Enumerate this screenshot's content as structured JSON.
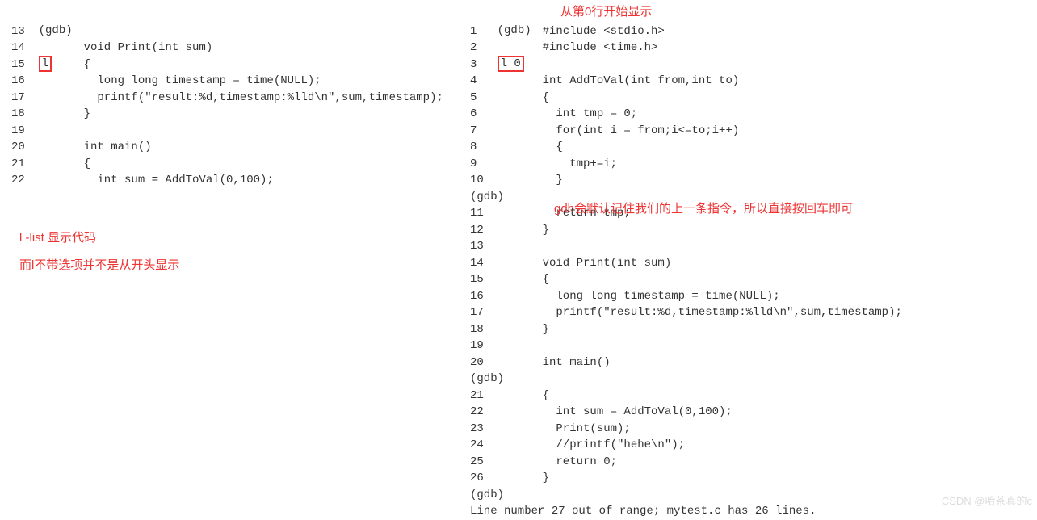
{
  "left": {
    "prompt": "(gdb)",
    "cmd_boxed": "l",
    "lines": [
      {
        "n": "13",
        "t": ""
      },
      {
        "n": "14",
        "t": "    void Print(int sum)"
      },
      {
        "n": "15",
        "t": "    {"
      },
      {
        "n": "16",
        "t": "      long long timestamp = time(NULL);"
      },
      {
        "n": "17",
        "t": "      printf(\"result:%d,timestamp:%lld\\n\",sum,timestamp);"
      },
      {
        "n": "18",
        "t": "    }"
      },
      {
        "n": "19",
        "t": ""
      },
      {
        "n": "20",
        "t": "    int main()"
      },
      {
        "n": "21",
        "t": "    {"
      },
      {
        "n": "22",
        "t": "      int sum = AddToVal(0,100);"
      }
    ],
    "anno1": "l -list 显示代码",
    "anno2": "而l不带选项并不是从开头显示"
  },
  "right": {
    "prompt": "(gdb)",
    "cmd_boxed": "l 0",
    "anno_top": "从第0行开始显示",
    "anno_mid": "gdb会默认记住我们的上一条指令，所以直接按回车即可",
    "segments": [
      {
        "type": "line",
        "n": "1",
        "t": "    #include <stdio.h>"
      },
      {
        "type": "line",
        "n": "2",
        "t": "    #include <time.h>"
      },
      {
        "type": "line",
        "n": "3",
        "t": ""
      },
      {
        "type": "line",
        "n": "4",
        "t": "    int AddToVal(int from,int to)"
      },
      {
        "type": "line",
        "n": "5",
        "t": "    {"
      },
      {
        "type": "line",
        "n": "6",
        "t": "      int tmp = 0;"
      },
      {
        "type": "line",
        "n": "7",
        "t": "      for(int i = from;i<=to;i++)"
      },
      {
        "type": "line",
        "n": "8",
        "t": "      {"
      },
      {
        "type": "line",
        "n": "9",
        "t": "        tmp+=i;"
      },
      {
        "type": "line",
        "n": "10",
        "t": "      }"
      },
      {
        "type": "prompt",
        "t": "(gdb) "
      },
      {
        "type": "line",
        "n": "11",
        "t": "      return tmp;"
      },
      {
        "type": "line",
        "n": "12",
        "t": "    }"
      },
      {
        "type": "line",
        "n": "13",
        "t": ""
      },
      {
        "type": "line",
        "n": "14",
        "t": "    void Print(int sum)"
      },
      {
        "type": "line",
        "n": "15",
        "t": "    {"
      },
      {
        "type": "line",
        "n": "16",
        "t": "      long long timestamp = time(NULL);"
      },
      {
        "type": "line",
        "n": "17",
        "t": "      printf(\"result:%d,timestamp:%lld\\n\",sum,timestamp);"
      },
      {
        "type": "line",
        "n": "18",
        "t": "    }"
      },
      {
        "type": "line",
        "n": "19",
        "t": ""
      },
      {
        "type": "line",
        "n": "20",
        "t": "    int main()"
      },
      {
        "type": "prompt",
        "t": "(gdb) "
      },
      {
        "type": "line",
        "n": "21",
        "t": "    {"
      },
      {
        "type": "line",
        "n": "22",
        "t": "      int sum = AddToVal(0,100);"
      },
      {
        "type": "line",
        "n": "23",
        "t": "      Print(sum);"
      },
      {
        "type": "line",
        "n": "24",
        "t": "      //printf(\"hehe\\n\");"
      },
      {
        "type": "line",
        "n": "25",
        "t": "      return 0;"
      },
      {
        "type": "line",
        "n": "26",
        "t": "    }"
      },
      {
        "type": "prompt",
        "t": "(gdb) "
      },
      {
        "type": "msg",
        "t": "Line number 27 out of range; mytest.c has 26 lines."
      }
    ]
  },
  "watermark": "CSDN @哈茶真的c"
}
